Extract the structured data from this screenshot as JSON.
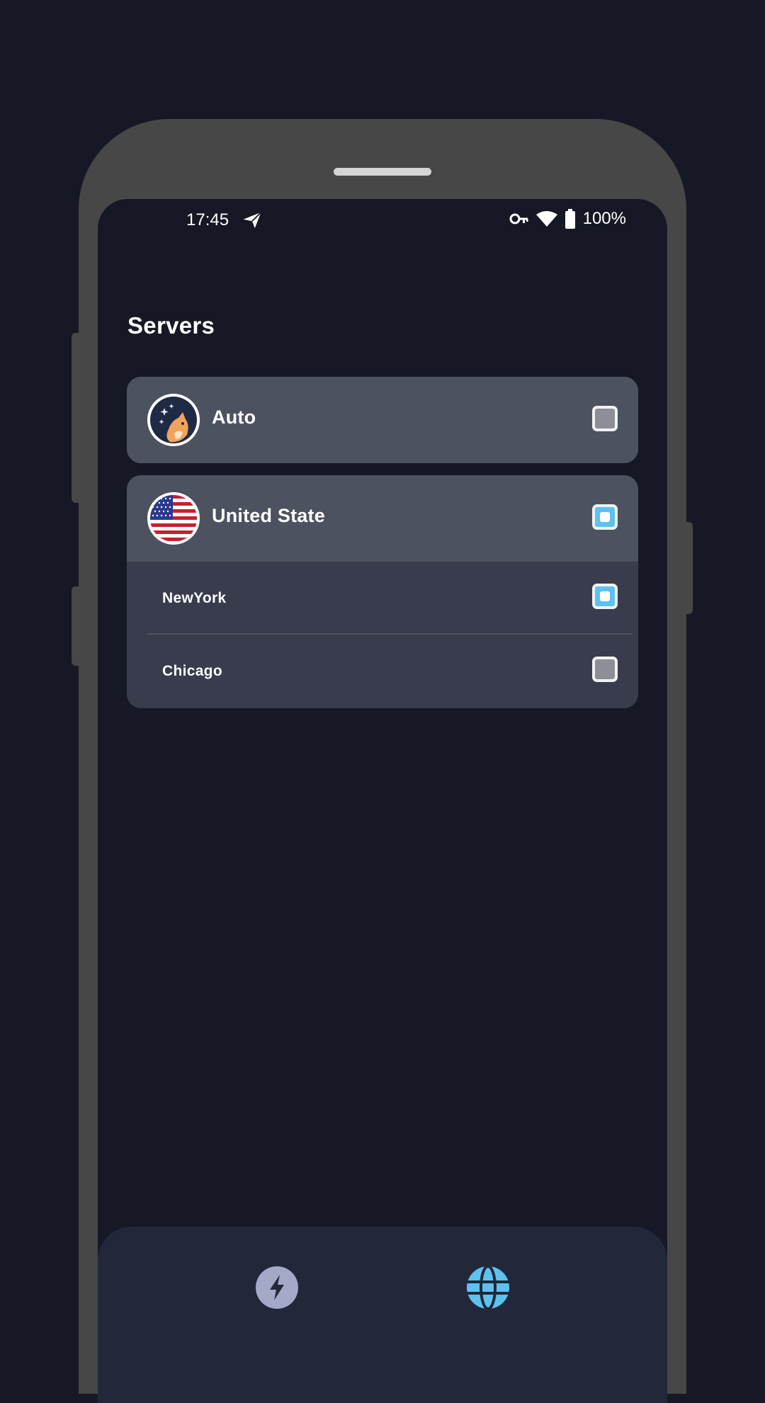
{
  "status_bar": {
    "time": "17:45",
    "battery": "100%",
    "icons": [
      "send-icon",
      "vpn-key-icon",
      "wifi-icon",
      "battery-icon"
    ]
  },
  "page": {
    "title": "Servers"
  },
  "servers": {
    "auto": {
      "label": "Auto",
      "icon": "shiba-logo",
      "selected": false
    },
    "united_state": {
      "label": "United State",
      "icon": "us-flag",
      "selected": true,
      "cities": [
        {
          "label": "NewYork",
          "selected": true
        },
        {
          "label": "Chicago",
          "selected": false
        }
      ]
    }
  },
  "bottom_nav": {
    "items": [
      {
        "icon": "lightning-icon",
        "active": false
      },
      {
        "icon": "globe-icon",
        "active": true
      }
    ]
  },
  "colors": {
    "background": "#161925",
    "card": "#4d5261",
    "card_expanded": "#383c4c",
    "accent": "#5ec2ef",
    "nav": "#22283a"
  }
}
